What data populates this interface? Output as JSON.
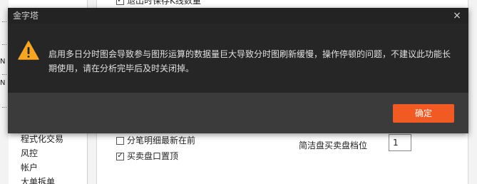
{
  "background": {
    "top_option": {
      "label": "退出时保存K线数量",
      "checked": true
    },
    "nav_items": [
      {
        "label": "程式化交易"
      },
      {
        "label": "风控"
      },
      {
        "label": "帐户"
      },
      {
        "label": "大单拆单"
      }
    ],
    "options": [
      {
        "label": "分笔明细最新在前",
        "checked": false
      },
      {
        "label": "买卖盘口置顶",
        "checked": true
      }
    ],
    "depth_setting": {
      "label": "简洁盘买卖盘档位",
      "value": "1"
    },
    "check_glyph": "✓",
    "mini_glyph": "N"
  },
  "dialog": {
    "title": "金字塔",
    "close_glyph": "×",
    "icon": "warning-icon",
    "message": "启用多日分时图会导致参与图形运算的数据量巨大导致分时图刷新缓慢，操作停顿的问题，不建议此功能长期使用，请在分析完毕后及时关闭掉。",
    "ok_label": "确定",
    "colors": {
      "accent": "#f15a22",
      "warning": "#f6a623",
      "title_bar": "#232323",
      "body": "#262626",
      "footer": "#3b3b3b"
    }
  }
}
